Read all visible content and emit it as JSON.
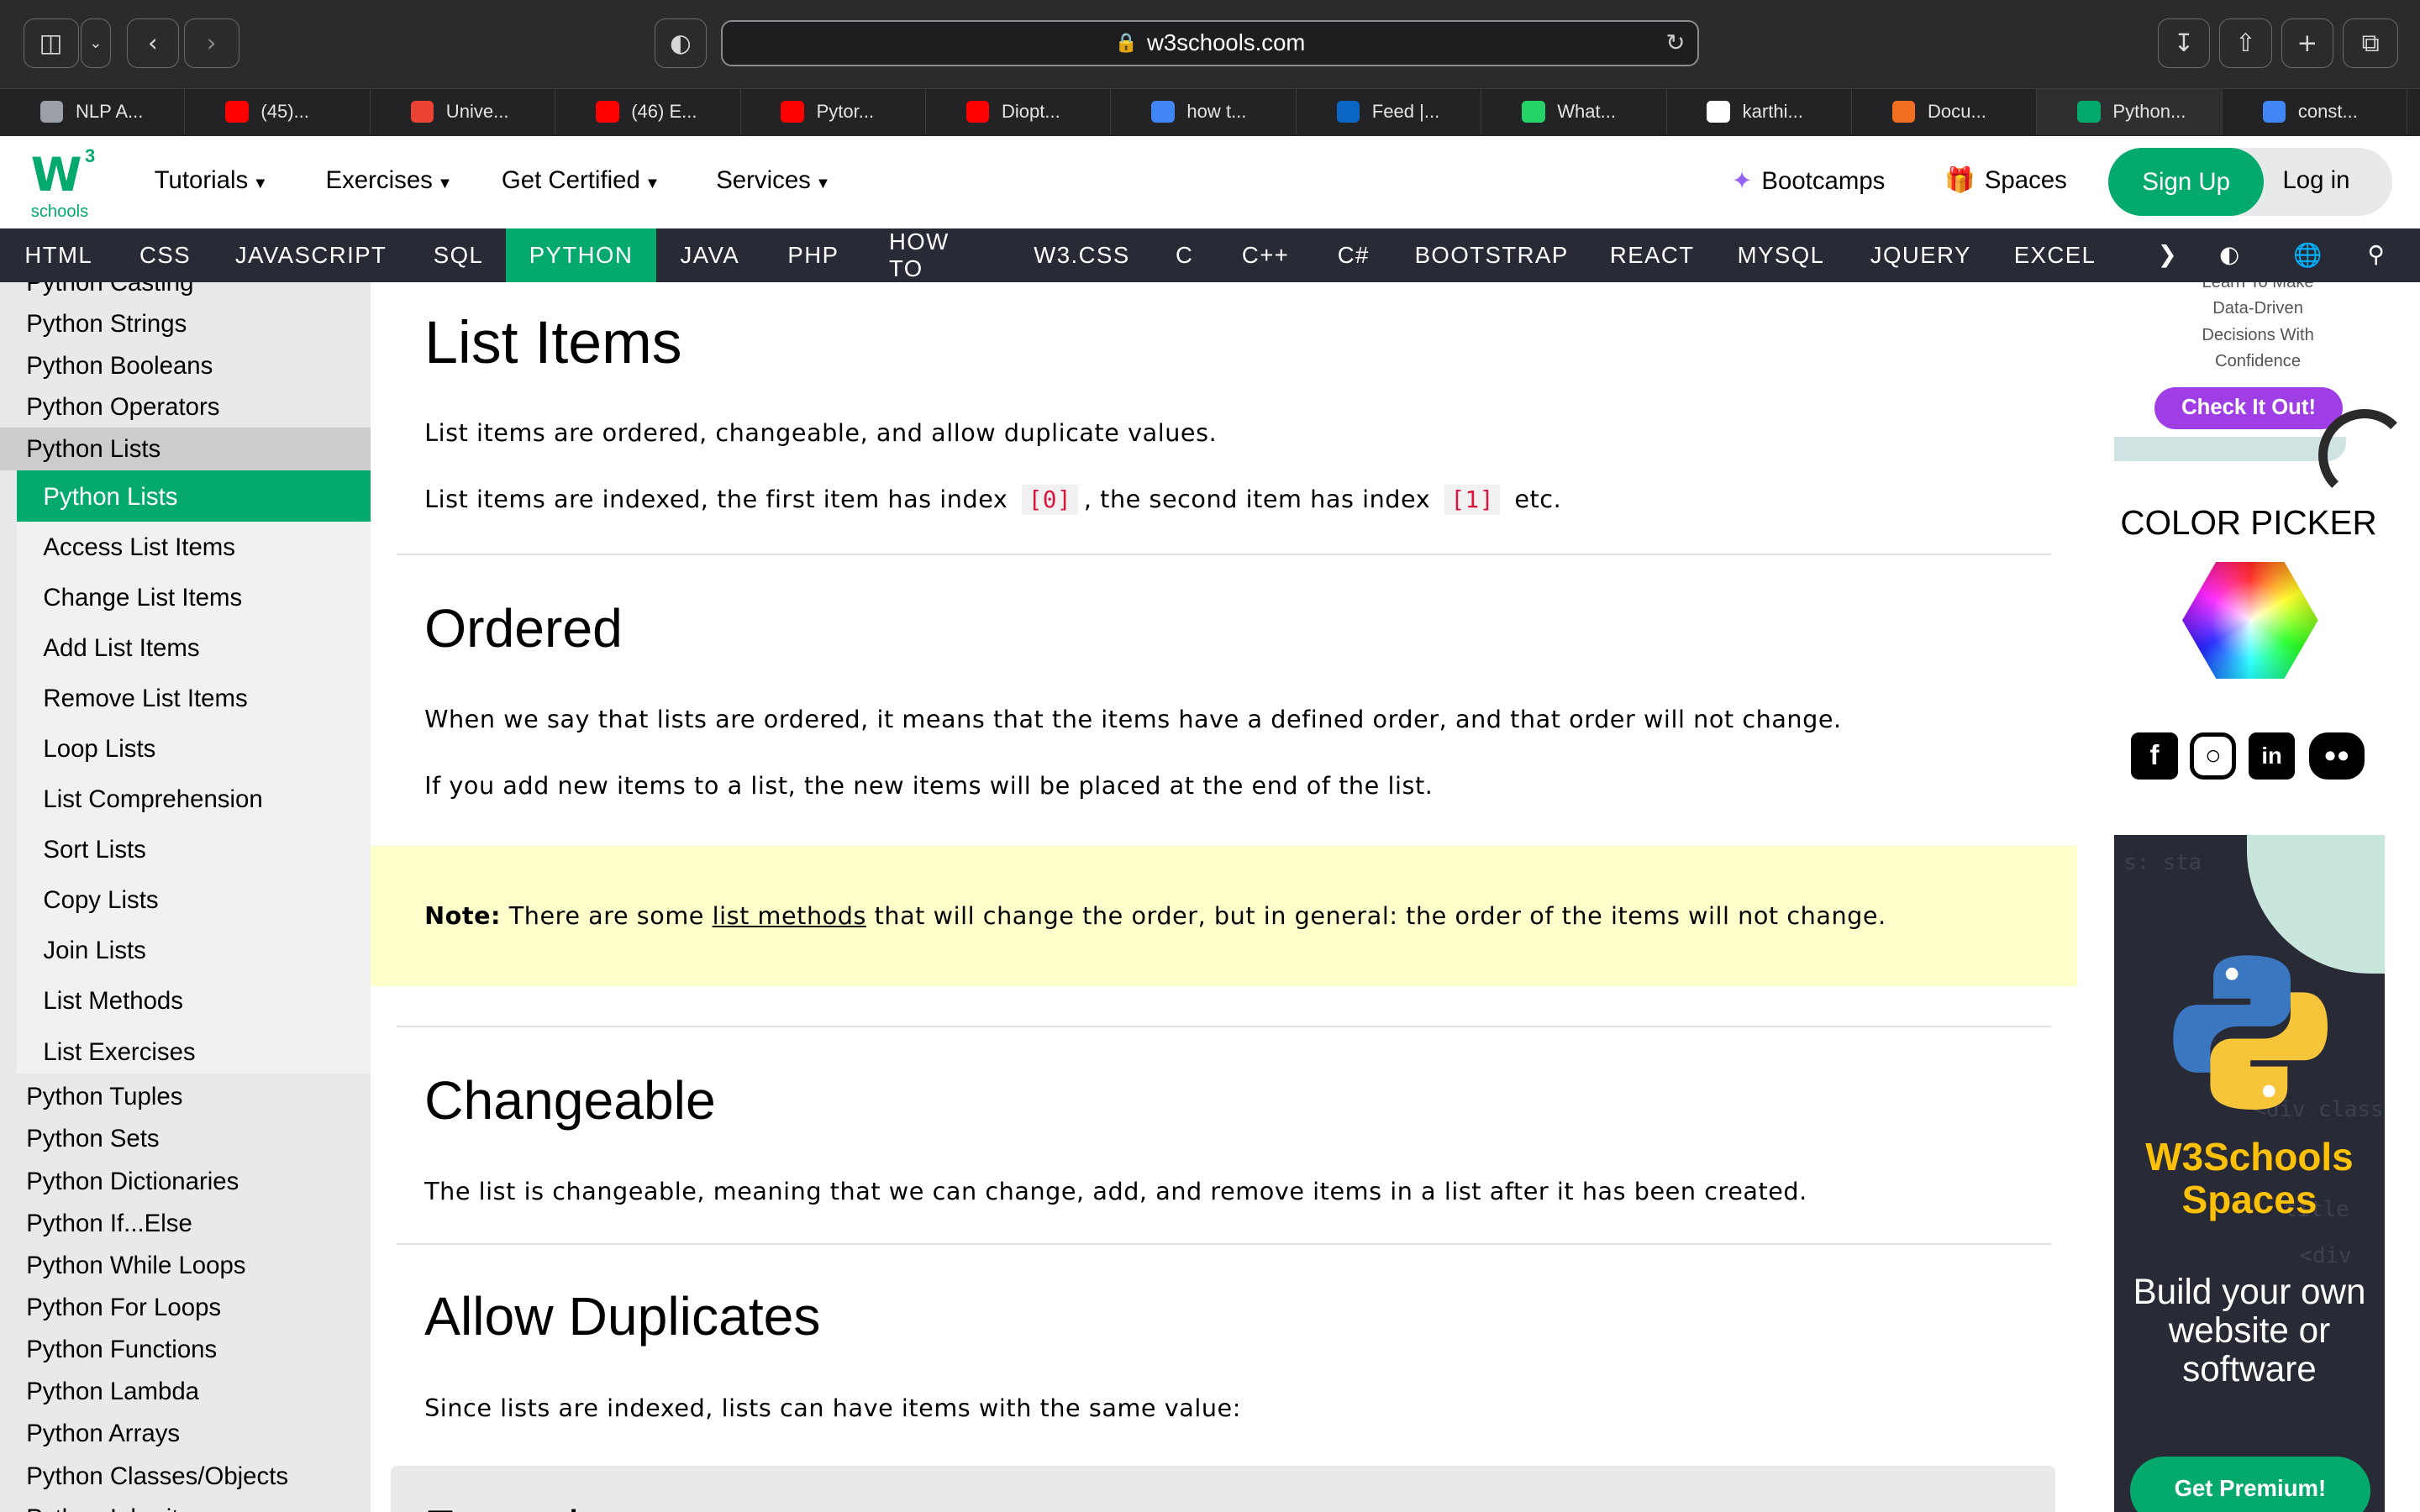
{
  "browser": {
    "url": "w3schools.com",
    "tabs": [
      {
        "label": "NLP A...",
        "color": "#9aa0a6"
      },
      {
        "label": "(45)...",
        "color": "#ff0000"
      },
      {
        "label": "Unive...",
        "color": "#ea4335"
      },
      {
        "label": "(46) E...",
        "color": "#ff0000"
      },
      {
        "label": "Pytor...",
        "color": "#ff0000"
      },
      {
        "label": "Diopt...",
        "color": "#ff0000"
      },
      {
        "label": "how t...",
        "color": "#4285f4"
      },
      {
        "label": "Feed |...",
        "color": "#0a66c2"
      },
      {
        "label": "What...",
        "color": "#25d366"
      },
      {
        "label": "karthi...",
        "color": "#ffffff"
      },
      {
        "label": "Docu...",
        "color": "#f26f21"
      },
      {
        "label": "Python...",
        "color": "#04AA6D"
      },
      {
        "label": "const...",
        "color": "#4285f4"
      }
    ]
  },
  "header": {
    "logo_superscript": "3",
    "logo_text": "schools",
    "nav": [
      "Tutorials",
      "Exercises",
      "Get Certified",
      "Services"
    ],
    "bootcamps": "Bootcamps",
    "spaces": "Spaces",
    "signup": "Sign Up",
    "login": "Log in"
  },
  "langbar": {
    "items": [
      "HTML",
      "CSS",
      "JAVASCRIPT",
      "SQL",
      "PYTHON",
      "JAVA",
      "PHP",
      "HOW TO",
      "W3.CSS",
      "C",
      "C++",
      "C#",
      "BOOTSTRAP",
      "REACT",
      "MYSQL",
      "JQUERY",
      "EXCEL"
    ],
    "active": "PYTHON"
  },
  "sidebar": {
    "cut_top": "Python Casting",
    "items_before": [
      "Python Strings",
      "Python Booleans",
      "Python Operators"
    ],
    "lists_head": "Python Lists",
    "subitems": [
      "Python Lists",
      "Access List Items",
      "Change List Items",
      "Add List Items",
      "Remove List Items",
      "Loop Lists",
      "List Comprehension",
      "Sort Lists",
      "Copy Lists",
      "Join Lists",
      "List Methods",
      "List Exercises"
    ],
    "items_after": [
      "Python Tuples",
      "Python Sets",
      "Python Dictionaries",
      "Python If...Else",
      "Python While Loops",
      "Python For Loops",
      "Python Functions",
      "Python Lambda",
      "Python Arrays",
      "Python Classes/Objects",
      "Python Inheritance"
    ]
  },
  "main": {
    "title": "List Items",
    "intro1": "List items are ordered, changeable, and allow duplicate values.",
    "intro2_a": "List items are indexed, the first item has index",
    "intro2_code1": "[0]",
    "intro2_b": ", the second item has index",
    "intro2_code2": "[1]",
    "intro2_c": "etc.",
    "ordered_h": "Ordered",
    "ordered_p1": "When we say that lists are ordered, it means that the items have a defined order, and that order will not change.",
    "ordered_p2": "If you add new items to a list, the new items will be placed at the end of the list.",
    "note_label": "Note:",
    "note_a": " There are some ",
    "note_link": "list methods",
    "note_b": " that will change the order, but in general: the order of the items will not change.",
    "changeable_h": "Changeable",
    "changeable_p": "The list is changeable, meaning that we can change, add, and remove items in a list after it has been created.",
    "duplicates_h": "Allow Duplicates",
    "duplicates_p": "Since lists are indexed, lists can have items with the same value:",
    "example_h": "Example"
  },
  "right": {
    "ad1_lines": [
      "Learn To Make",
      "Data-Driven",
      "Decisions With",
      "Confidence"
    ],
    "ad1_cta": "Check It Out!",
    "color_picker": "COLOR PICKER",
    "socials": [
      "facebook",
      "instagram",
      "linkedin",
      "discord"
    ],
    "ad2_code": [
      "s: sta",
      "{",
      "<div className",
      "title",
      "<div"
    ],
    "ad2_brand": "W3Schools Spaces",
    "ad2_sub": "Build your own website or software",
    "ad2_cta": "Get Premium!"
  }
}
